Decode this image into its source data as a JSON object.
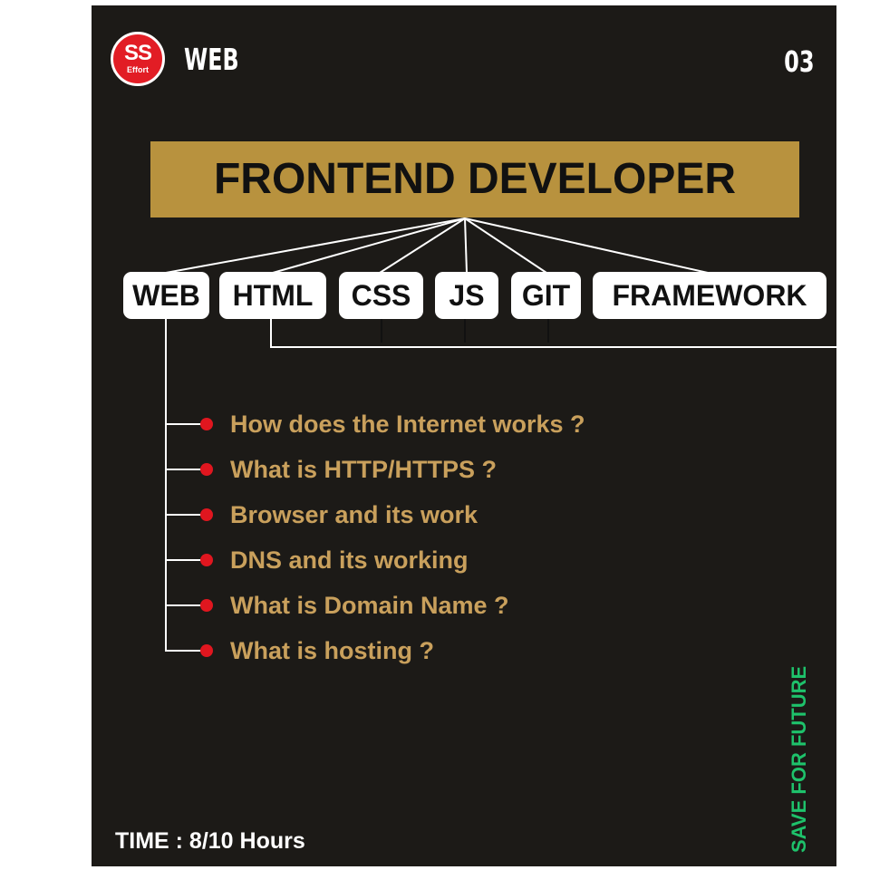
{
  "header": {
    "logo_main": "SS",
    "logo_sub": "Effort",
    "category": "WEB",
    "page_number": "03"
  },
  "title": "FRONTEND DEVELOPER",
  "tags": [
    "WEB",
    "HTML",
    "CSS",
    "JS",
    "GIT",
    "FRAMEWORK"
  ],
  "topics": [
    "How does the Internet works ?",
    "What is HTTP/HTTPS ?",
    "Browser and its work",
    "DNS and its working",
    "What is Domain Name ?",
    "What is hosting ?"
  ],
  "footer": {
    "time": "TIME : 8/10 Hours",
    "save": "SAVE FOR FUTURE"
  },
  "colors": {
    "background": "#1c1a17",
    "title_bar": "#b8923e",
    "topic_text": "#c9a05c",
    "bullet": "#e0161f",
    "logo": "#e21d25",
    "save_text": "#1ec26b"
  }
}
